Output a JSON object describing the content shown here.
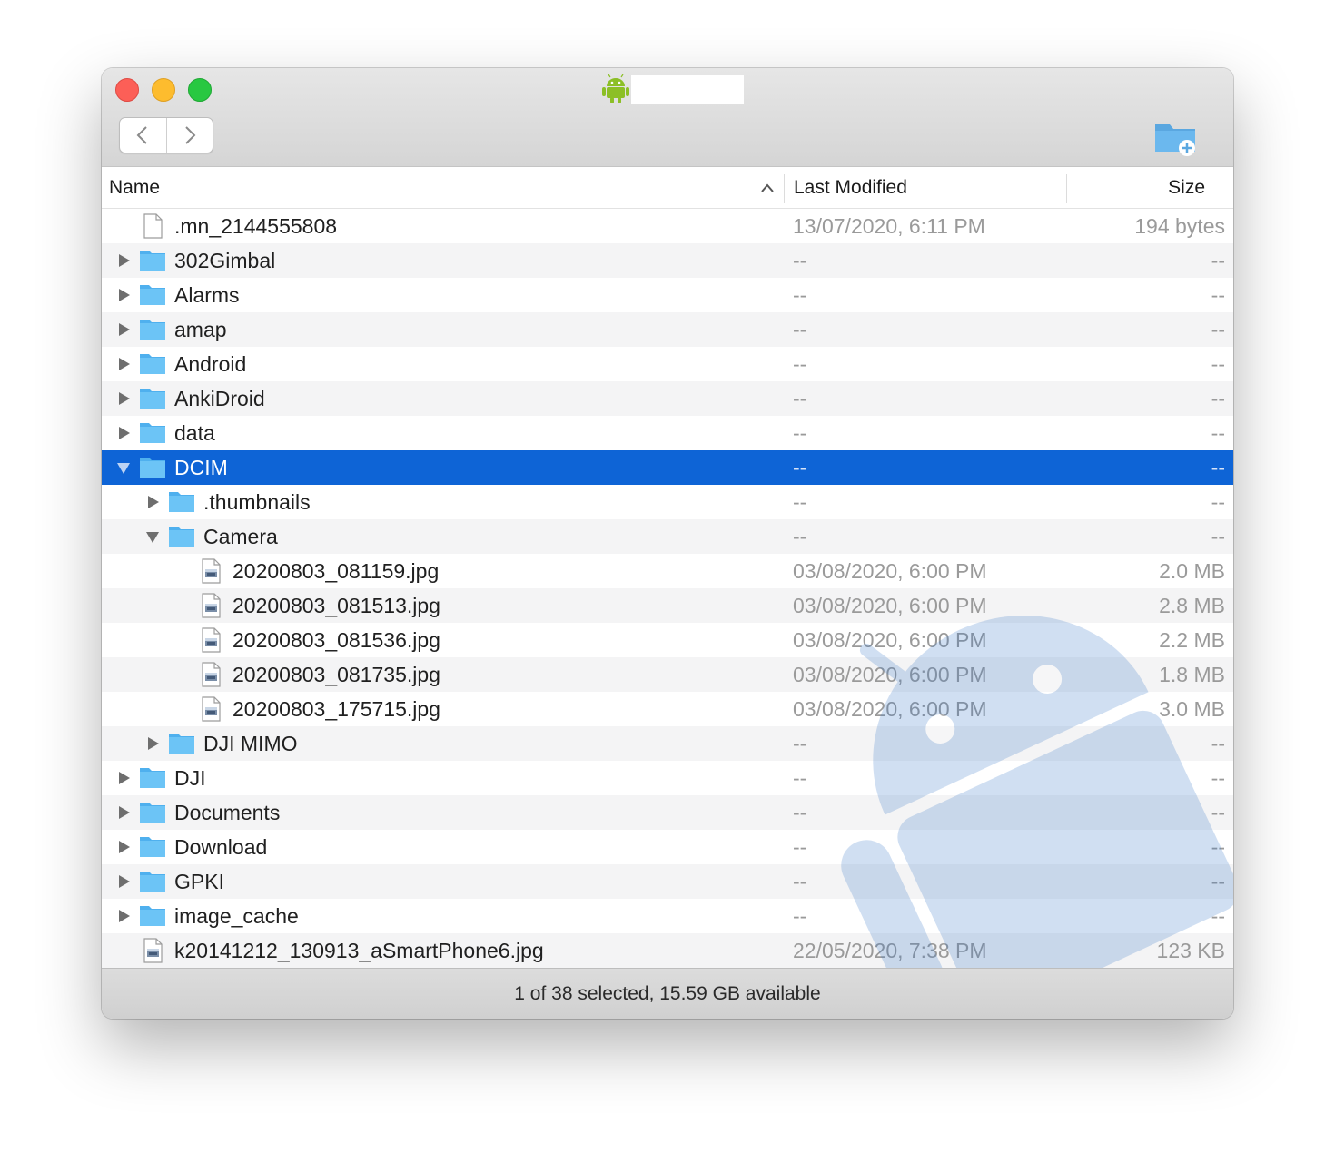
{
  "window": {
    "title_icon": "android-icon"
  },
  "toolbar": {
    "back_icon": "chevron-left-icon",
    "forward_icon": "chevron-right-icon",
    "new_folder_icon": "new-folder-icon"
  },
  "columns": {
    "name": "Name",
    "last_modified": "Last Modified",
    "size": "Size",
    "sort_icon": "chevron-up-icon"
  },
  "rows": [
    {
      "name": ".mn_2144555808",
      "modified": "13/07/2020, 6:11 PM",
      "size": "194 bytes",
      "kind": "file",
      "depth": 0,
      "disclosure": "none"
    },
    {
      "name": "302Gimbal",
      "modified": "--",
      "size": "--",
      "kind": "folder",
      "depth": 0,
      "disclosure": "collapsed"
    },
    {
      "name": "Alarms",
      "modified": "--",
      "size": "--",
      "kind": "folder",
      "depth": 0,
      "disclosure": "collapsed"
    },
    {
      "name": "amap",
      "modified": "--",
      "size": "--",
      "kind": "folder",
      "depth": 0,
      "disclosure": "collapsed"
    },
    {
      "name": "Android",
      "modified": "--",
      "size": "--",
      "kind": "folder",
      "depth": 0,
      "disclosure": "collapsed"
    },
    {
      "name": "AnkiDroid",
      "modified": "--",
      "size": "--",
      "kind": "folder",
      "depth": 0,
      "disclosure": "collapsed"
    },
    {
      "name": "data",
      "modified": "--",
      "size": "--",
      "kind": "folder",
      "depth": 0,
      "disclosure": "collapsed"
    },
    {
      "name": "DCIM",
      "modified": "--",
      "size": "--",
      "kind": "folder",
      "depth": 0,
      "disclosure": "expanded",
      "selected": true
    },
    {
      "name": ".thumbnails",
      "modified": "--",
      "size": "--",
      "kind": "folder",
      "depth": 1,
      "disclosure": "collapsed"
    },
    {
      "name": "Camera",
      "modified": "--",
      "size": "--",
      "kind": "folder",
      "depth": 1,
      "disclosure": "expanded"
    },
    {
      "name": "20200803_081159.jpg",
      "modified": "03/08/2020, 6:00 PM",
      "size": "2.0 MB",
      "kind": "image",
      "depth": 2,
      "disclosure": "none"
    },
    {
      "name": "20200803_081513.jpg",
      "modified": "03/08/2020, 6:00 PM",
      "size": "2.8 MB",
      "kind": "image",
      "depth": 2,
      "disclosure": "none"
    },
    {
      "name": "20200803_081536.jpg",
      "modified": "03/08/2020, 6:00 PM",
      "size": "2.2 MB",
      "kind": "image",
      "depth": 2,
      "disclosure": "none"
    },
    {
      "name": "20200803_081735.jpg",
      "modified": "03/08/2020, 6:00 PM",
      "size": "1.8 MB",
      "kind": "image",
      "depth": 2,
      "disclosure": "none"
    },
    {
      "name": "20200803_175715.jpg",
      "modified": "03/08/2020, 6:00 PM",
      "size": "3.0 MB",
      "kind": "image",
      "depth": 2,
      "disclosure": "none"
    },
    {
      "name": "DJI MIMO",
      "modified": "--",
      "size": "--",
      "kind": "folder",
      "depth": 1,
      "disclosure": "collapsed"
    },
    {
      "name": "DJI",
      "modified": "--",
      "size": "--",
      "kind": "folder",
      "depth": 0,
      "disclosure": "collapsed"
    },
    {
      "name": "Documents",
      "modified": "--",
      "size": "--",
      "kind": "folder",
      "depth": 0,
      "disclosure": "collapsed"
    },
    {
      "name": "Download",
      "modified": "--",
      "size": "--",
      "kind": "folder",
      "depth": 0,
      "disclosure": "collapsed"
    },
    {
      "name": "GPKI",
      "modified": "--",
      "size": "--",
      "kind": "folder",
      "depth": 0,
      "disclosure": "collapsed"
    },
    {
      "name": "image_cache",
      "modified": "--",
      "size": "--",
      "kind": "folder",
      "depth": 0,
      "disclosure": "collapsed"
    },
    {
      "name": "k20141212_130913_aSmartPhone6.jpg",
      "modified": "22/05/2020, 7:38 PM",
      "size": "123 KB",
      "kind": "image",
      "depth": 0,
      "disclosure": "none"
    }
  ],
  "status": {
    "text": "1 of 38 selected, 15.59 GB available"
  },
  "colors": {
    "selection": "#0e64d6",
    "folder": "#5ab9f2",
    "close": "#fc5f57",
    "minimize": "#fdbc2e",
    "zoom": "#28c841",
    "android_green": "#8cbf26"
  }
}
